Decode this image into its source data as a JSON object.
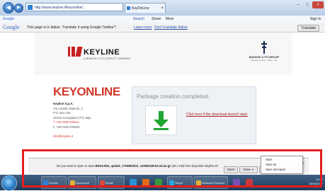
{
  "browser": {
    "address": "http://www.keyline.it/keyonline/...",
    "tab_title": "KeyOnLine",
    "search_field": "Google",
    "search_label": "Search",
    "share_label": "Share",
    "more_label": "More",
    "signin_label": "Sign In",
    "nav_back_icon": "back-arrow-icon",
    "nav_forward_icon": "forward-arrow-icon"
  },
  "translate_bar": {
    "logo": "Google",
    "message": "This page is in Italian. Translate it using Google Toolbar?",
    "learn_more": "Learn more",
    "never": "Don't translate Italian",
    "translate_button": "Translate"
  },
  "page": {
    "brand": "KEYLINE",
    "brand_sub": "A BIANCHI 1770 GROUP COMPANY",
    "group_logo": "BIANCHI 1770 GROUP",
    "group_sub": "Keylane & Lana · Silca · etc.",
    "keyonline_title": "KEYONLINE",
    "company_lines": [
      "Keyline S.p.A.",
      "Via Camillo Bianchi, 2",
      "P.O. Box 151",
      "31015 Conegliano (TV) Italy",
      "T +39 0438 202511",
      "F +39 0438 202520",
      "",
      "info@keyline.it"
    ],
    "package_status": "Package creation completed.",
    "download_link": "Click here if the download doesn't start.",
    "download_icon": "green-down-arrow-icon"
  },
  "download_bar": {
    "prompt_pre": "Do you want to open or save ",
    "filename": "BDK5.994_update_1708903011_14069218103.24.tar.gz",
    "prompt_post": " (36.1 KB) from keyonline.keyline.it?",
    "open_label": "Open",
    "save_label": "Save",
    "cancel_label": "Cancel",
    "close_icon": "close-icon"
  },
  "save_menu": {
    "items": [
      "Save",
      "Save as",
      "Save and open"
    ]
  },
  "taskbar": {
    "items": [
      "Keyline",
      "Documenti",
      "Gmail",
      "Skype",
      "Windows Explorer"
    ],
    "clock_time": "10:48",
    "clock_date": "15/06/2017"
  },
  "colors": {
    "brand_red": "#d13a2a",
    "highlight_red": "#e41e1e",
    "download_green": "#21a533"
  }
}
